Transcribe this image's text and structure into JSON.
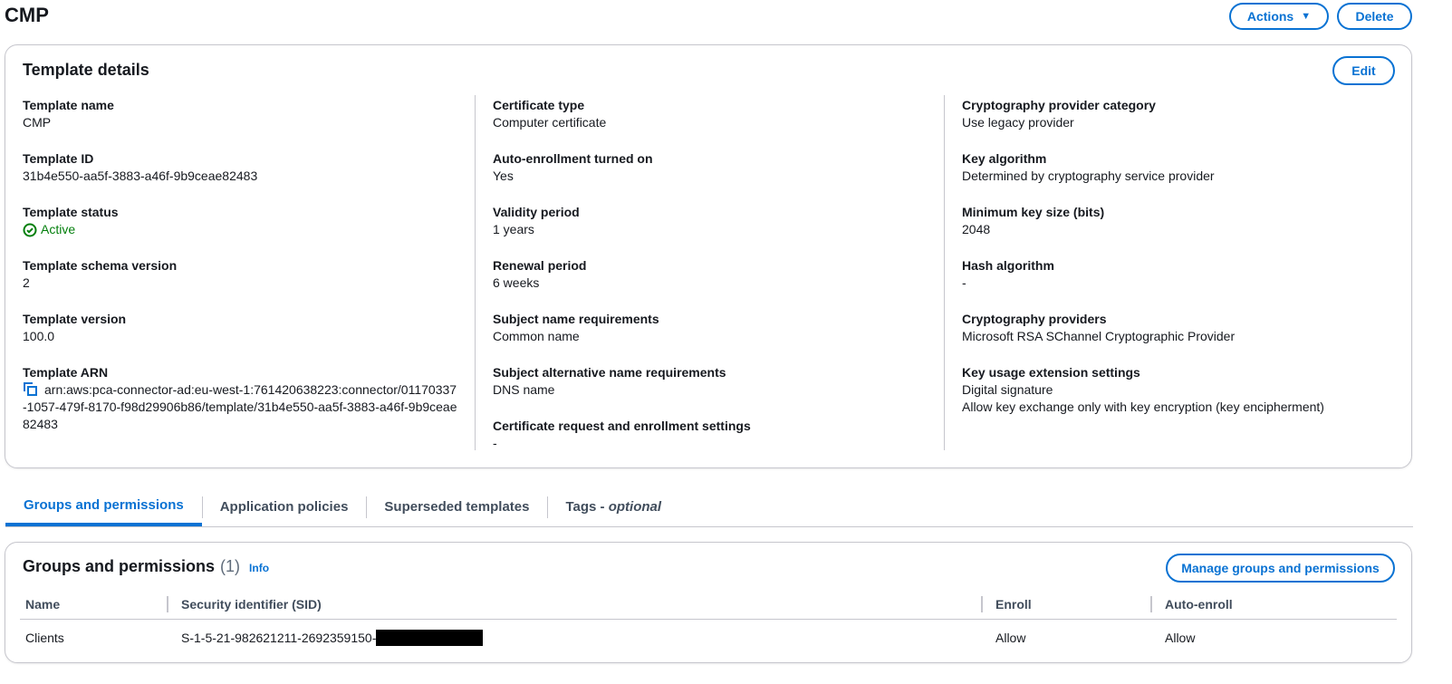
{
  "header": {
    "title": "CMP",
    "actions_label": "Actions",
    "delete_label": "Delete"
  },
  "details": {
    "title": "Template details",
    "edit_label": "Edit",
    "col1": [
      {
        "label": "Template name",
        "value": "CMP"
      },
      {
        "label": "Template ID",
        "value": "31b4e550-aa5f-3883-a46f-9b9ceae82483"
      },
      {
        "label": "Template status",
        "value": "Active"
      },
      {
        "label": "Template schema version",
        "value": "2"
      },
      {
        "label": "Template version",
        "value": "100.0"
      },
      {
        "label": "Template ARN",
        "value": "arn:aws:pca-connector-ad:eu-west-1:761420638223:connector/01170337-1057-479f-8170-f98d29906b86/template/31b4e550-aa5f-3883-a46f-9b9ceae82483"
      }
    ],
    "col2": [
      {
        "label": "Certificate type",
        "value": "Computer certificate"
      },
      {
        "label": "Auto-enrollment turned on",
        "value": "Yes"
      },
      {
        "label": "Validity period",
        "value": "1 years"
      },
      {
        "label": "Renewal period",
        "value": "6 weeks"
      },
      {
        "label": "Subject name requirements",
        "value": "Common name"
      },
      {
        "label": "Subject alternative name requirements",
        "value": "DNS name"
      },
      {
        "label": "Certificate request and enrollment settings",
        "value": "-"
      }
    ],
    "col3": [
      {
        "label": "Cryptography provider category",
        "value": "Use legacy provider"
      },
      {
        "label": "Key algorithm",
        "value": "Determined by cryptography service provider"
      },
      {
        "label": "Minimum key size (bits)",
        "value": "2048"
      },
      {
        "label": "Hash algorithm",
        "value": "-"
      },
      {
        "label": "Cryptography providers",
        "value": "Microsoft RSA SChannel Cryptographic Provider"
      },
      {
        "label": "Key usage extension settings",
        "value": "Digital signature",
        "value2": "Allow key exchange only with key encryption (key encipherment)"
      }
    ]
  },
  "tabs": [
    {
      "label": "Groups and permissions"
    },
    {
      "label": "Application policies"
    },
    {
      "label": "Superseded templates"
    },
    {
      "label": "Tags - ",
      "italic": "optional"
    }
  ],
  "groups": {
    "title": "Groups and permissions",
    "count": "(1)",
    "info": "Info",
    "manage_label": "Manage groups and permissions",
    "columns": [
      "Name",
      "Security identifier (SID)",
      "Enroll",
      "Auto-enroll"
    ],
    "rows": [
      {
        "name": "Clients",
        "sid": "S-1-5-21-982621211-2692359150-",
        "enroll": "Allow",
        "auto_enroll": "Allow"
      }
    ]
  },
  "colors": {
    "accent": "#0972d3",
    "success": "#037f0c"
  }
}
